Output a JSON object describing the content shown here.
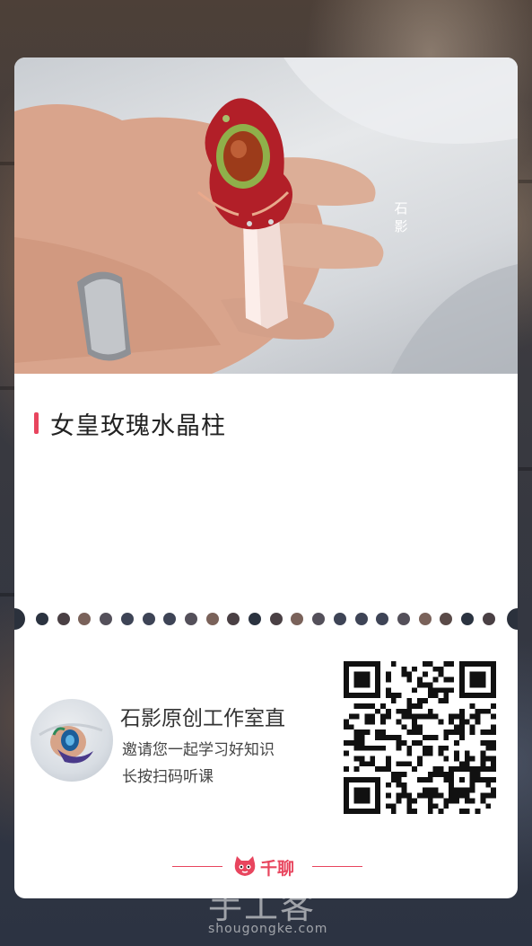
{
  "product": {
    "photo_watermark": "石影",
    "title": "女皇玫瑰水晶柱"
  },
  "share": {
    "host_name": "石影原创工作室直",
    "invite_text": "邀请您一起学习好知识",
    "scan_hint": "长按扫码听课"
  },
  "brand": {
    "name": "千聊",
    "accent_color": "#e8455e"
  },
  "site_watermark": {
    "name": "手工客",
    "url": "shougongke.com"
  },
  "icons": [
    "qr-code-icon",
    "qianliao-mascot-icon"
  ]
}
